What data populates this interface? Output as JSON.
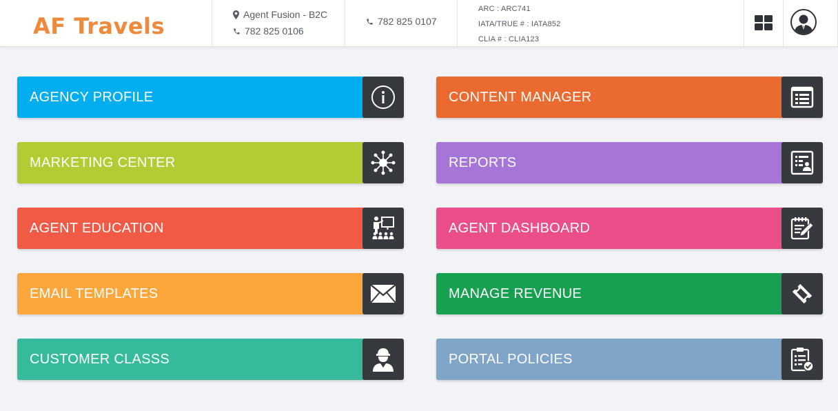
{
  "header": {
    "logo": "AF Travels",
    "agent_name": "Agent Fusion - B2C",
    "phone_1": "782 825 0106",
    "phone_2": "782 825 0107",
    "arc": "ARC : ARC741",
    "iata": "IATA/TRUE # : IATA852",
    "clia": "CLIA # : CLIA123",
    "icons": [
      "map-marker-icon",
      "phone-icon",
      "grid-icon",
      "user-avatar-icon"
    ]
  },
  "tiles": [
    {
      "label": "AGENCY PROFILE",
      "color": "#03aef0",
      "icon": "info-icon"
    },
    {
      "label": "CONTENT MANAGER",
      "color": "#ea6a2f",
      "icon": "list-icon"
    },
    {
      "label": "MARKETING CENTER",
      "color": "#b2cd34",
      "icon": "network-icon"
    },
    {
      "label": "REPORTS",
      "color": "#a675d8",
      "icon": "report-icon"
    },
    {
      "label": "AGENT EDUCATION",
      "color": "#f15a44",
      "icon": "presentation-icon"
    },
    {
      "label": "AGENT DASHBOARD",
      "color": "#eb4e8b",
      "icon": "edit-note-icon"
    },
    {
      "label": "EMAIL TEMPLATES",
      "color": "#fda63b",
      "icon": "envelope-icon"
    },
    {
      "label": "MANAGE REVENUE",
      "color": "#17a050",
      "icon": "ticket-icon"
    },
    {
      "label": "CUSTOMER CLASSS",
      "color": "#35bb9c",
      "icon": "customer-icon"
    },
    {
      "label": "PORTAL POLICIES",
      "color": "#7fa6c9",
      "icon": "clipboard-check-icon"
    }
  ]
}
